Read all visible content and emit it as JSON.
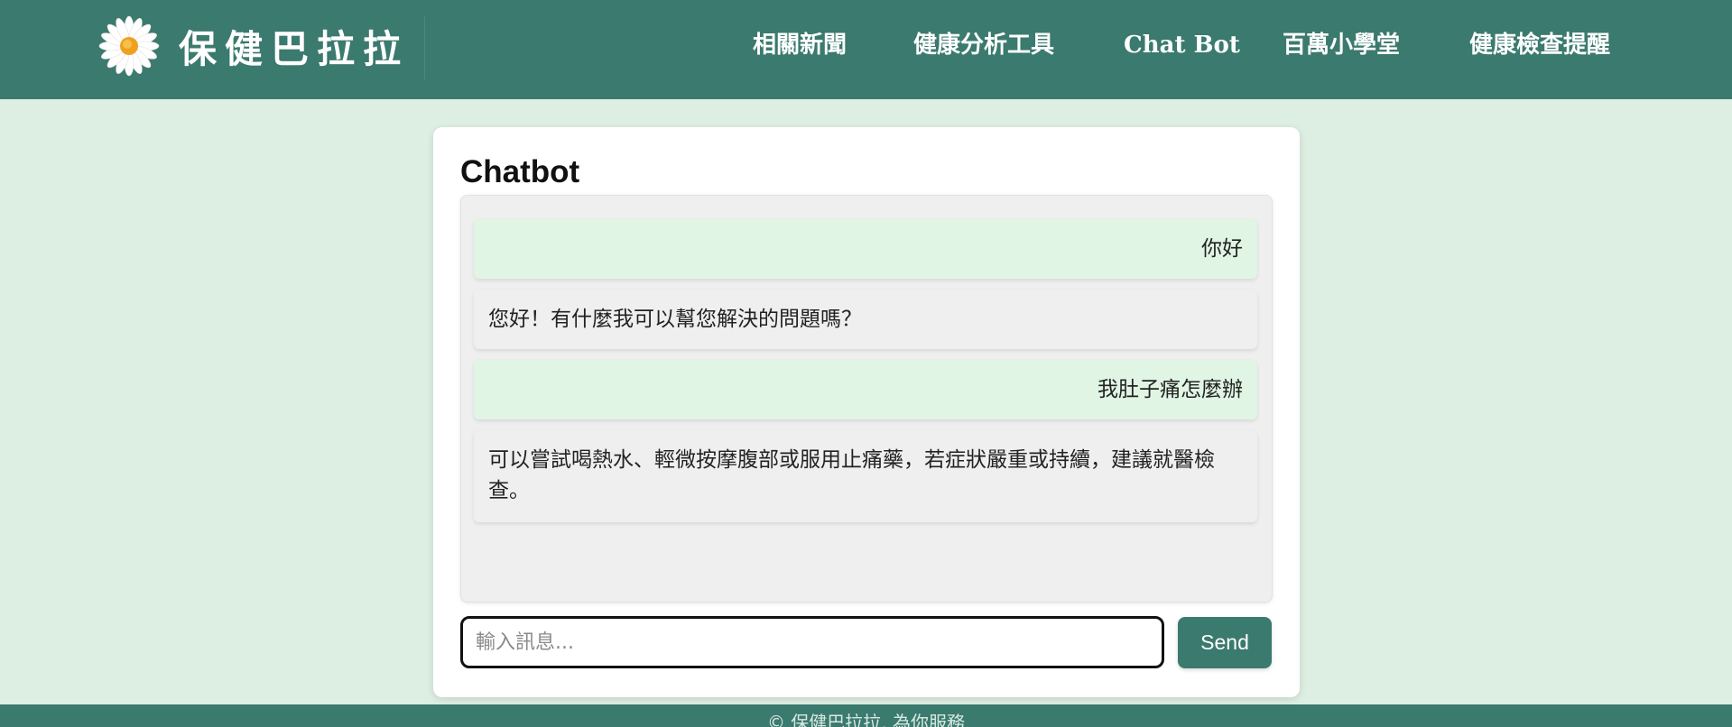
{
  "brand": {
    "name": "保健巴拉拉",
    "logo_icon": "daisy-icon"
  },
  "nav": {
    "items": [
      {
        "label": "相關新聞"
      },
      {
        "label": "健康分析工具"
      },
      {
        "label": "Chat Bot"
      },
      {
        "label": "百萬小學堂"
      },
      {
        "label": "健康檢查提醒"
      }
    ]
  },
  "chat": {
    "title": "Chatbot",
    "messages": [
      {
        "role": "user",
        "text": "你好"
      },
      {
        "role": "bot",
        "text": "您好！有什麼我可以幫您解決的問題嗎？"
      },
      {
        "role": "user",
        "text": "我肚子痛怎麼辦"
      },
      {
        "role": "bot",
        "text": "可以嘗試喝熱水、輕微按摩腹部或服用止痛藥，若症狀嚴重或持續，建議就醫檢查。"
      }
    ],
    "input_placeholder": "輸入訊息...",
    "input_value": "",
    "send_label": "Send"
  },
  "footer": {
    "text": "© 保健巴拉拉, 為你服務"
  },
  "colors": {
    "header_bg": "#3b7a6e",
    "page_bg": "#ddeee2",
    "user_bubble": "#e0f5e3",
    "bot_bubble": "#efefef"
  }
}
